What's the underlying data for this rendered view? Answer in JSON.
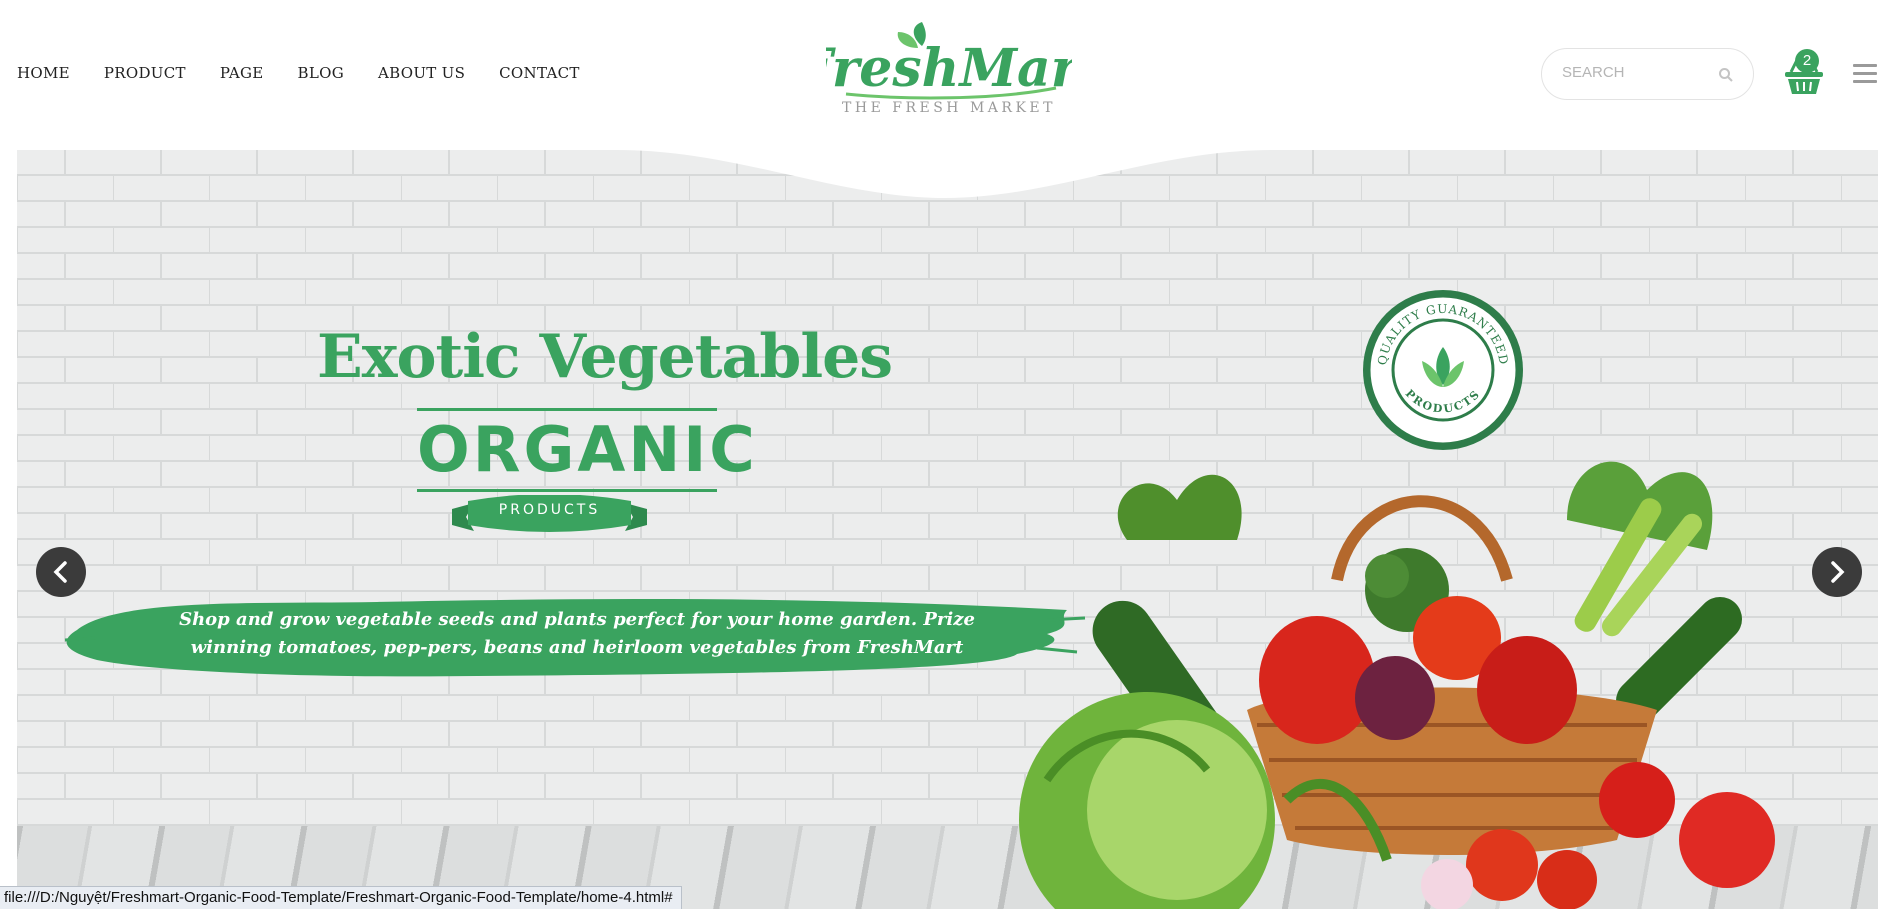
{
  "nav": {
    "items": [
      "HOME",
      "PRODUCT",
      "PAGE",
      "BLOG",
      "ABOUT US",
      "CONTACT"
    ]
  },
  "logo": {
    "name": "FreshMart",
    "tagline": "THE FRESH MARKET"
  },
  "search": {
    "placeholder": "SEARCH",
    "icon": "search-icon"
  },
  "cart": {
    "count": "2",
    "icon": "basket-icon"
  },
  "menu": {
    "icon": "hamburger-menu-icon"
  },
  "hero": {
    "title": "Exotic Vegetables",
    "organic": "ORGANIC",
    "organic_ribbon": "PRODUCTS",
    "tagline": "Shop and grow vegetable seeds and plants perfect for your home garden. Prize winning tomatoes, pep-pers, beans and heirloom vegetables from FreshMart",
    "badge_top": "QUALITY GUARANTEED",
    "badge_bottom": "PRODUCTS",
    "prev_icon": "chevron-left-icon",
    "next_icon": "chevron-right-icon"
  },
  "status_bar": {
    "url": "file:///D:/Nguyệt/Freshmart-Organic-Food-Template/Freshmart-Organic-Food-Template/home-4.html#"
  },
  "colors": {
    "brand_green": "#3aa35f",
    "arrow_bg": "#3b3b3b",
    "wall": "#e9eaea"
  }
}
